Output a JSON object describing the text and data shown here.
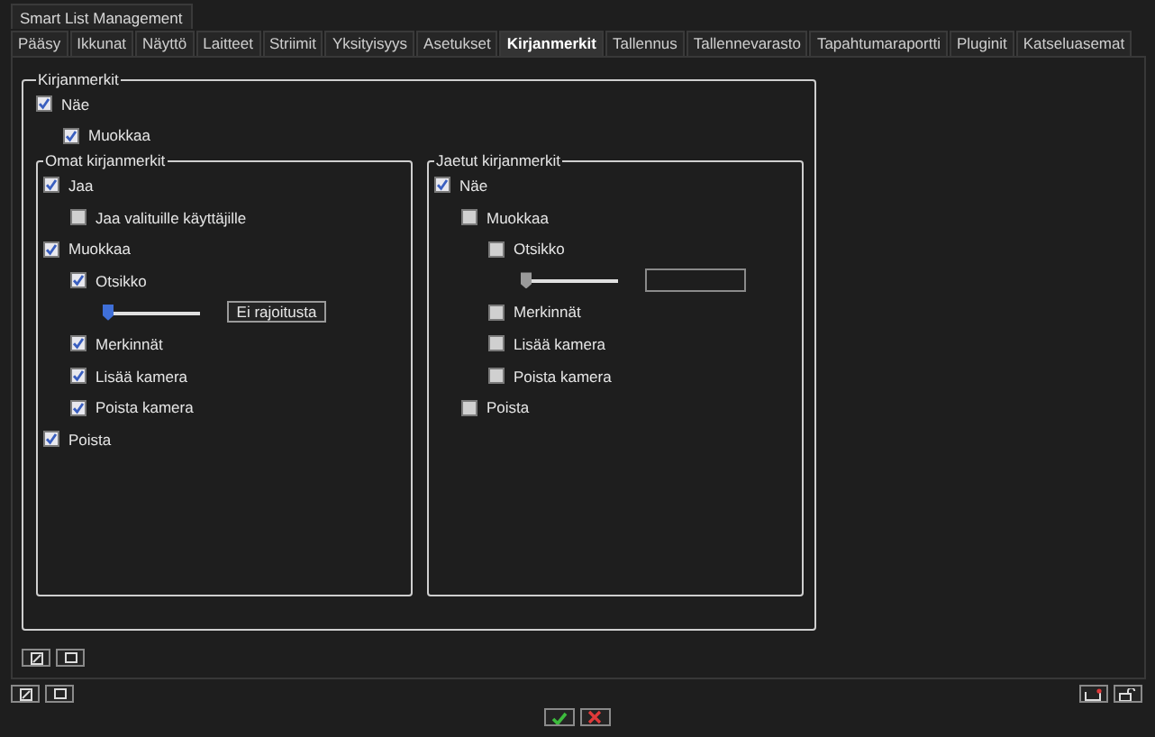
{
  "title_tab": "Smart List Management",
  "tabs": [
    {
      "label": "Pääsy",
      "selected": false
    },
    {
      "label": "Ikkunat",
      "selected": false
    },
    {
      "label": "Näyttö",
      "selected": false
    },
    {
      "label": "Laitteet",
      "selected": false
    },
    {
      "label": "Striimit",
      "selected": false
    },
    {
      "label": "Yksityisyys",
      "selected": false
    },
    {
      "label": "Asetukset",
      "selected": false
    },
    {
      "label": "Kirjanmerkit",
      "selected": true
    },
    {
      "label": "Tallennus",
      "selected": false
    },
    {
      "label": "Tallennevarasto",
      "selected": false
    },
    {
      "label": "Tapahtumaraportti",
      "selected": false
    },
    {
      "label": "Pluginit",
      "selected": false
    },
    {
      "label": "Katseluasemat",
      "selected": false
    }
  ],
  "section": {
    "title": "Kirjanmerkit",
    "items": [
      {
        "kind": "checkbox",
        "label": "Näe",
        "checked": true,
        "children": [
          {
            "kind": "checkbox",
            "label": "Muokkaa",
            "checked": true
          }
        ]
      }
    ],
    "groups": [
      {
        "title": "Omat kirjanmerkit",
        "items": [
          {
            "kind": "checkbox",
            "label": "Jaa",
            "checked": true,
            "children": [
              {
                "kind": "checkbox",
                "label": "Jaa valituille käyttäjille",
                "checked": false
              }
            ]
          },
          {
            "kind": "checkbox",
            "label": "Muokkaa",
            "checked": true,
            "children": [
              {
                "kind": "checkbox",
                "label": "Otsikko",
                "checked": true,
                "children": [
                  {
                    "kind": "slider",
                    "level": 0,
                    "disabled": false,
                    "control": {
                      "kind": "button",
                      "label": "Ei rajoitusta"
                    }
                  }
                ]
              },
              {
                "kind": "checkbox",
                "label": "Merkinnät",
                "checked": true
              },
              {
                "kind": "checkbox",
                "label": "Lisää kamera",
                "checked": true
              },
              {
                "kind": "checkbox",
                "label": "Poista kamera",
                "checked": true
              }
            ]
          },
          {
            "kind": "checkbox",
            "label": "Poista",
            "checked": true
          }
        ]
      },
      {
        "title": "Jaetut kirjanmerkit",
        "items": [
          {
            "kind": "checkbox",
            "label": "Näe",
            "checked": true,
            "children": [
              {
                "kind": "checkbox",
                "label": "Muokkaa",
                "checked": false,
                "children": [
                  {
                    "kind": "checkbox",
                    "label": "Otsikko",
                    "checked": false,
                    "children": [
                      {
                        "kind": "slider",
                        "level": 0,
                        "disabled": true,
                        "control": {
                          "kind": "field"
                        }
                      }
                    ]
                  },
                  {
                    "kind": "checkbox",
                    "label": "Merkinnät",
                    "checked": false
                  },
                  {
                    "kind": "checkbox",
                    "label": "Lisää kamera",
                    "checked": false
                  },
                  {
                    "kind": "checkbox",
                    "label": "Poista kamera",
                    "checked": false
                  }
                ]
              },
              {
                "kind": "checkbox",
                "label": "Poista",
                "checked": false
              }
            ]
          }
        ]
      }
    ]
  }
}
